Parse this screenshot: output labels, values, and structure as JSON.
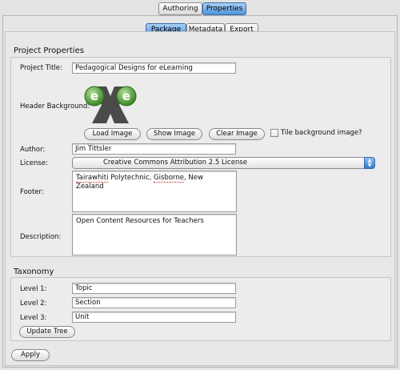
{
  "top_tabs": [
    {
      "label": "Authoring",
      "active": false
    },
    {
      "label": "Properties",
      "active": true
    }
  ],
  "sub_tabs": [
    {
      "label": "Package",
      "active": true
    },
    {
      "label": "Metadata",
      "active": false
    },
    {
      "label": "Export",
      "active": false
    }
  ],
  "project_properties": {
    "section_title": "Project Properties",
    "project_title_label": "Project Title:",
    "project_title_value": "Pedagogical Designs for eLearning",
    "header_background_label": "Header Background:",
    "header_logo_letters": "eXe",
    "load_image_label": "Load Image",
    "show_image_label": "Show Image",
    "clear_image_label": "Clear Image",
    "tile_background_label": "Tile background image?",
    "tile_background_checked": false,
    "author_label": "Author:",
    "author_value": "Jim Tittsler",
    "license_label": "License:",
    "license_value": "Creative Commons Attribution 2.5 License",
    "footer_label": "Footer:",
    "footer_value_parts": [
      "Tairawhiti",
      " Polytechnic, ",
      "Gisborne",
      ", New Zealand"
    ],
    "description_label": "Description:",
    "description_value": "Open Content Resources for Teachers"
  },
  "taxonomy": {
    "section_title": "Taxonomy",
    "level1_label": "Level 1:",
    "level1_value": "Topic",
    "level2_label": "Level 2:",
    "level2_value": "Section",
    "level3_label": "Level 3:",
    "level3_value": "Unit",
    "update_tree_label": "Update Tree"
  },
  "apply_label": "Apply",
  "colors": {
    "accent_blue": "#4d94dc",
    "logo_green": "#5faa3a",
    "logo_dark": "#3a3a3a"
  }
}
